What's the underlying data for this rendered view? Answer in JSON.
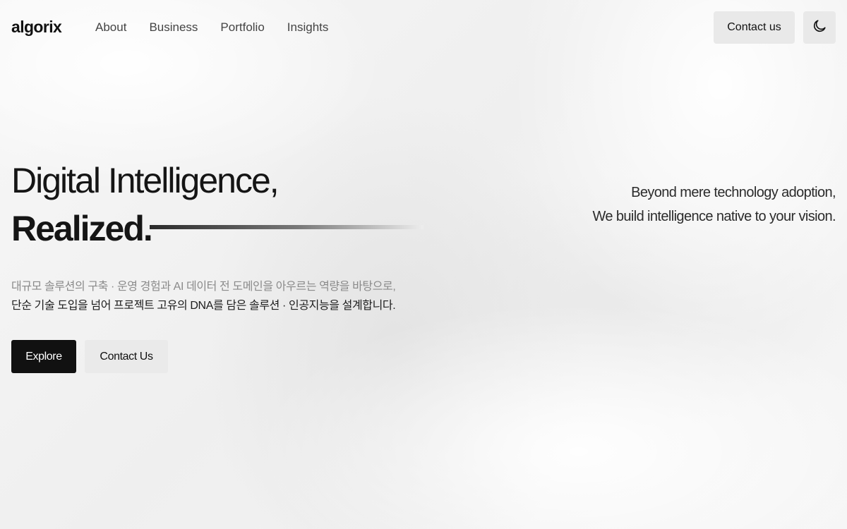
{
  "brand": {
    "logo_text": "algorix"
  },
  "nav": {
    "items": [
      {
        "label": "About"
      },
      {
        "label": "Business"
      },
      {
        "label": "Portfolio"
      },
      {
        "label": "Insights"
      }
    ]
  },
  "header": {
    "contact_label": "Contact us",
    "theme_toggle_icon": "moon-icon"
  },
  "hero": {
    "headline_line1": "Digital Intelligence,",
    "headline_line2": "Realized.",
    "tagline_line1": "Beyond mere technology adoption,",
    "tagline_line2": "We build intelligence native to your vision.",
    "description_line1": "대규모 솔루션의 구축 · 운영 경험과 AI 데이터 전 도메인을 아우르는 역량을 바탕으로,",
    "description_line2": "단순 기술 도입을 넘어 프로젝트 고유의 DNA를 담은 솔루션 · 인공지능을 설계합니다.",
    "primary_button": "Explore",
    "secondary_button": "Contact Us"
  },
  "colors": {
    "primary_button_bg": "#111111",
    "secondary_button_bg": "#eaeaea",
    "text_primary": "#151515",
    "text_muted": "#8a8a8a"
  }
}
